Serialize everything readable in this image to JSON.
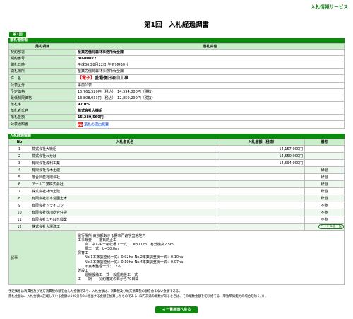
{
  "header": {
    "service_name": "入札情報サービス",
    "page_title": "第1回　入札経過調書",
    "round_tab": "第1回"
  },
  "summary": {
    "section_label": "落札者情報",
    "col_item": "落札項目",
    "col_content": "落札内容",
    "rows": [
      {
        "label": "契約部署",
        "value": "産業労働局森林事務所保全課",
        "style": "bold"
      },
      {
        "label": "契約番号",
        "value": "30-00027",
        "style": "bold"
      },
      {
        "label": "開札日時",
        "value": "平成30年8月22日 午前9時30分",
        "style": ""
      },
      {
        "label": "開札場所",
        "value": "産業労働局森林事務所保全課",
        "style": ""
      },
      {
        "label": "件　名",
        "tag": "【電子】",
        "value": "盛堀復旧治山工事",
        "style": "title"
      },
      {
        "label": "公表区分",
        "value": "事前公表",
        "style": ""
      },
      {
        "label": "予定価格",
        "value": "15,761,520円（税込）　14,594,000円（税抜）",
        "style": ""
      },
      {
        "label": "最低制限価格",
        "value": "13,808,033円（税込）　12,859,290円（税抜）",
        "style": ""
      },
      {
        "label": "落札率",
        "value": "97.0%",
        "style": "bold"
      },
      {
        "label": "落札者氏名",
        "value": "株式会社大機組",
        "style": "bold"
      },
      {
        "label": "落札金額",
        "value": "15,289,560円",
        "style": "bold"
      },
      {
        "label": "公表通知書",
        "value": "落札の理由概要",
        "style": "pdf"
      }
    ]
  },
  "bidders": {
    "section_label": "入札経過情報",
    "headers": {
      "no": "No",
      "name": "入札者氏名",
      "amount": "入札金額（税抜）",
      "note": "備考"
    },
    "rows": [
      {
        "no": "1",
        "name": "株式会社大機組",
        "amount": "14,157,000円",
        "note": ""
      },
      {
        "no": "2",
        "name": "株式会社わかば",
        "amount": "14,550,000円",
        "note": ""
      },
      {
        "no": "3",
        "name": "有限会社浅利工業",
        "amount": "14,594,000円",
        "note": ""
      },
      {
        "no": "4",
        "name": "有限会社青木土建",
        "amount": "",
        "note": "辞退"
      },
      {
        "no": "5",
        "name": "落合興産有限会社",
        "amount": "",
        "note": "辞退"
      },
      {
        "no": "6",
        "name": "アール工業株式会社",
        "amount": "",
        "note": "辞退"
      },
      {
        "no": "7",
        "name": "株式会社林田土建",
        "amount": "",
        "note": "辞退"
      },
      {
        "no": "8",
        "name": "有限会社松本造園土木",
        "amount": "",
        "note": "辞退"
      },
      {
        "no": "9",
        "name": "有限会社トライコン",
        "amount": "",
        "note": "不参"
      },
      {
        "no": "10",
        "name": "有限会社秋川総合住設",
        "amount": "",
        "note": "不参"
      },
      {
        "no": "11",
        "name": "有限会社たちばな興業",
        "amount": "",
        "note": "不参"
      },
      {
        "no": "12",
        "name": "株式会社大澤建工",
        "amount": "",
        "note": "不参"
      }
    ],
    "hash_button": "ハッシュ値一覧"
  },
  "remarks": {
    "label": "記事",
    "text": "履行場所 東京都あきる野市戸倉字盆地地内\n工事概要　　落石防止工\n　　高エネルギー吸収柵工一式：L=30.0m、有効機高2.5m\n　　柵工一式：L=30.0m\n保育工\n　　No.1本数調整伐一式：0.02ha No.2本数調整伐一式：0.10ha\n　　No.3本数調整伐一式：0.10ha No.4本数調整伐一式：0.07ha\n　　不良木整理一式：12本\n仮設工\n　　運搬設備工一式　仮護施設工一式\n工　　期　　契約確定の日から70日間"
  },
  "footer": {
    "note1": "予定価格は消費税及び地方消費税の額を含んだ金額であり、入札金額は、消費税及び地方消費税の額を含まない金額である。",
    "note2": "落札金額は、入札金額に記載している金額に100分の8に相当する金額を加算したものである（1円未満の端数があるときは、その端数金額を切り捨てる（単独単価契約の場合を除く。））。",
    "back_button": "◄ 一覧画面へ戻る"
  }
}
